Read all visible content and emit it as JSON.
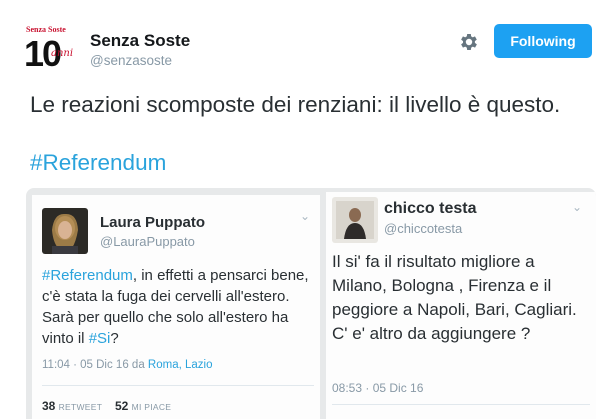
{
  "header": {
    "logo_text_top": "Senza Soste",
    "logo_number": "10",
    "logo_script": "anni",
    "name": "Senza Soste",
    "handle": "@senzasoste",
    "follow_label": "Following"
  },
  "tweet": {
    "text": "Le reazioni scomposte dei renziani: il livello è questo.",
    "hashtag": "#Referendum"
  },
  "embedded_left": {
    "name": "Laura Puppato",
    "handle": "@LauraPuppato",
    "body_hashtag": "#Referendum",
    "body_part1": ", in effetti a pensarci bene, c'è stata la fuga dei cervelli all'estero. Sarà per quello che solo all'estero ha vinto il ",
    "body_hashtag2": "#Si",
    "body_part2": "?",
    "timestamp": "11:04 · 05 Dic 16 da ",
    "location": "Roma, Lazio",
    "retweets_count": "38",
    "retweets_label": "RETWEET",
    "likes_count": "52",
    "likes_label": "MI PIACE"
  },
  "embedded_right": {
    "name": "chicco testa",
    "handle": "@chiccotesta",
    "body": "Il si' fa il risultato migliore a Milano, Bologna , Firenza e il peggiore a Napoli, Bari, Cagliari. C' e' altro da aggiungere ?",
    "timestamp": "08:53 · 05 Dic 16"
  },
  "colors": {
    "accent": "#1da1f2",
    "hashtag": "#2aa3dc",
    "muted": "#8899a6"
  },
  "icons": {
    "gear": "gear-icon",
    "chevron": "chevron-down-icon"
  }
}
